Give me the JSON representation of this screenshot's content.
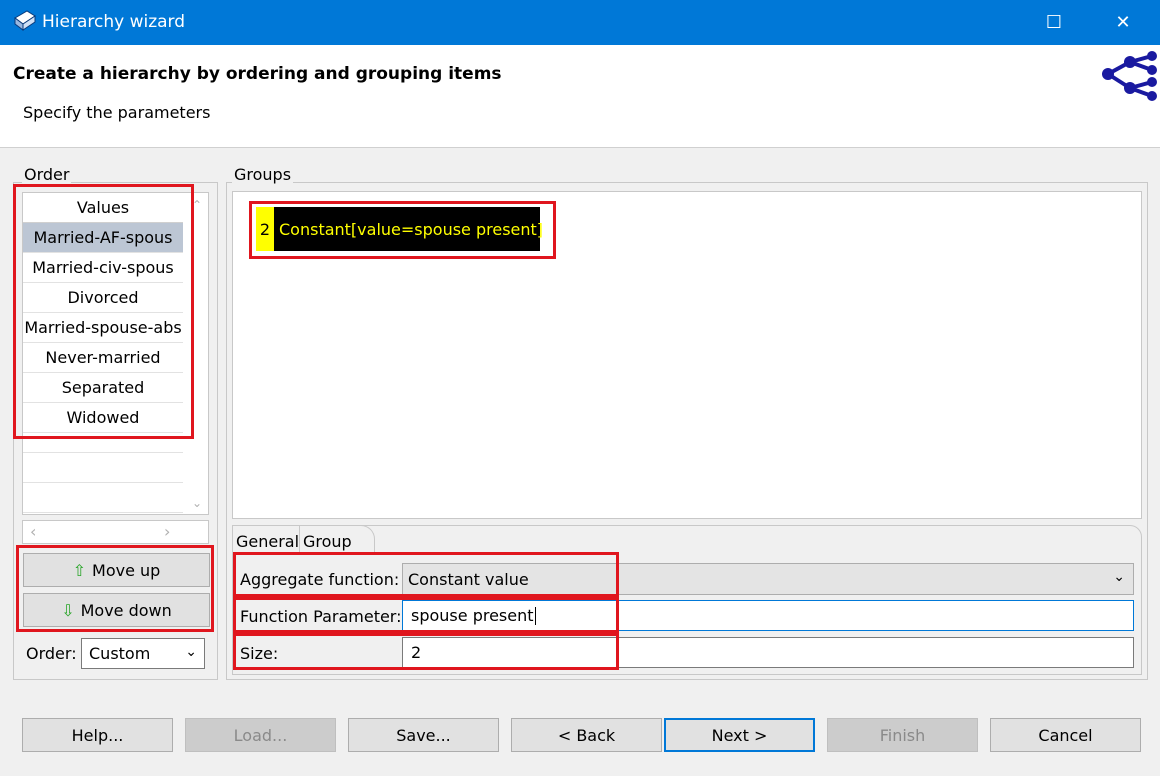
{
  "window": {
    "title": "Hierarchy wizard",
    "maximize_icon": "☐",
    "close_icon": "✕"
  },
  "header": {
    "title": "Create a hierarchy by ordering and grouping items",
    "subtitle": "Specify the parameters"
  },
  "order": {
    "label": "Order",
    "column_header": "Values",
    "items": [
      "Married-AF-spous",
      "Married-civ-spous",
      "Divorced",
      "Married-spouse-abs",
      "Never-married",
      "Separated",
      "Widowed"
    ],
    "move_up_label": "Move up",
    "move_down_label": "Move down",
    "order_label": "Order:",
    "order_value": "Custom"
  },
  "groups": {
    "label": "Groups",
    "group_number": "2",
    "group_text": "Constant[value=spouse present]"
  },
  "tabs": {
    "general": "General",
    "group": "Group"
  },
  "params": {
    "aggregate_label": "Aggregate function:",
    "aggregate_value": "Constant value",
    "function_param_label": "Function Parameter:",
    "function_param_value": "spouse present",
    "size_label": "Size:",
    "size_value": "2"
  },
  "footer": {
    "help": "Help...",
    "load": "Load...",
    "save": "Save...",
    "back": "< Back",
    "next": "Next >",
    "finish": "Finish",
    "cancel": "Cancel"
  },
  "colors": {
    "titlebar": "#0078d7",
    "highlight": "#e0161e",
    "group_bg": "#000000",
    "group_fg": "#ffff00"
  }
}
